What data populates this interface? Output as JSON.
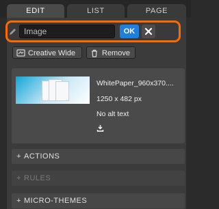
{
  "tabs": {
    "edit": "EDIT",
    "list": "LIST",
    "page": "PAGE"
  },
  "title_bar": {
    "input_placeholder": "Image",
    "ok_label": "OK",
    "accent": "#ff6a00",
    "ok_color": "#1f7fe0"
  },
  "actions": {
    "creative_wide_label": "Creative Wide",
    "remove_label": "Remove"
  },
  "image_card": {
    "filename": "WhitePaper_960x370....",
    "dimensions": "1250 x 482 px",
    "alt_status": "No alt text"
  },
  "sections": [
    {
      "label": "ACTIONS",
      "prefix": "+"
    },
    {
      "label": "RULES",
      "prefix": "+"
    },
    {
      "label": "MICRO-THEMES",
      "prefix": "+"
    }
  ]
}
